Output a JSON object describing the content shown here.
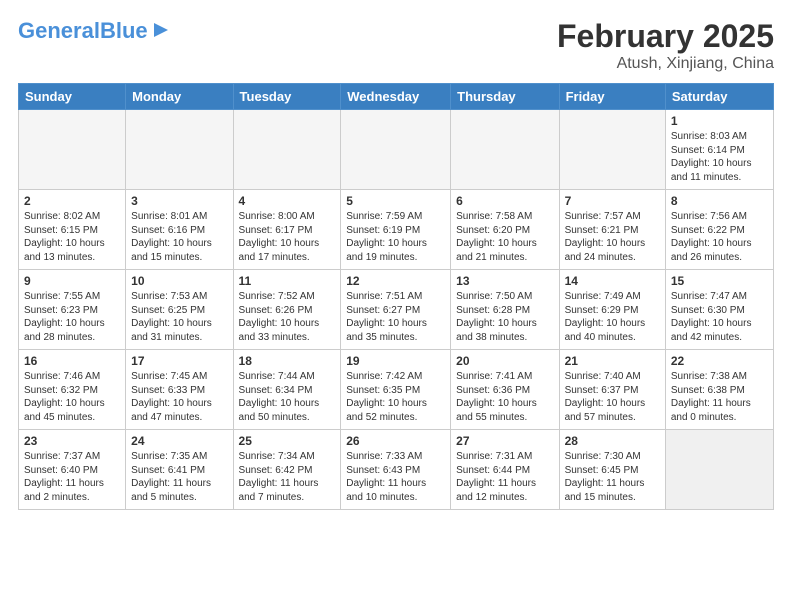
{
  "header": {
    "logo_general": "General",
    "logo_blue": "Blue",
    "title": "February 2025",
    "subtitle": "Atush, Xinjiang, China"
  },
  "days_of_week": [
    "Sunday",
    "Monday",
    "Tuesday",
    "Wednesday",
    "Thursday",
    "Friday",
    "Saturday"
  ],
  "weeks": [
    [
      {
        "day": "",
        "info": "",
        "empty": true
      },
      {
        "day": "",
        "info": "",
        "empty": true
      },
      {
        "day": "",
        "info": "",
        "empty": true
      },
      {
        "day": "",
        "info": "",
        "empty": true
      },
      {
        "day": "",
        "info": "",
        "empty": true
      },
      {
        "day": "",
        "info": "",
        "empty": true
      },
      {
        "day": "1",
        "info": "Sunrise: 8:03 AM\nSunset: 6:14 PM\nDaylight: 10 hours\nand 11 minutes."
      }
    ],
    [
      {
        "day": "2",
        "info": "Sunrise: 8:02 AM\nSunset: 6:15 PM\nDaylight: 10 hours\nand 13 minutes."
      },
      {
        "day": "3",
        "info": "Sunrise: 8:01 AM\nSunset: 6:16 PM\nDaylight: 10 hours\nand 15 minutes."
      },
      {
        "day": "4",
        "info": "Sunrise: 8:00 AM\nSunset: 6:17 PM\nDaylight: 10 hours\nand 17 minutes."
      },
      {
        "day": "5",
        "info": "Sunrise: 7:59 AM\nSunset: 6:19 PM\nDaylight: 10 hours\nand 19 minutes."
      },
      {
        "day": "6",
        "info": "Sunrise: 7:58 AM\nSunset: 6:20 PM\nDaylight: 10 hours\nand 21 minutes."
      },
      {
        "day": "7",
        "info": "Sunrise: 7:57 AM\nSunset: 6:21 PM\nDaylight: 10 hours\nand 24 minutes."
      },
      {
        "day": "8",
        "info": "Sunrise: 7:56 AM\nSunset: 6:22 PM\nDaylight: 10 hours\nand 26 minutes."
      }
    ],
    [
      {
        "day": "9",
        "info": "Sunrise: 7:55 AM\nSunset: 6:23 PM\nDaylight: 10 hours\nand 28 minutes."
      },
      {
        "day": "10",
        "info": "Sunrise: 7:53 AM\nSunset: 6:25 PM\nDaylight: 10 hours\nand 31 minutes."
      },
      {
        "day": "11",
        "info": "Sunrise: 7:52 AM\nSunset: 6:26 PM\nDaylight: 10 hours\nand 33 minutes."
      },
      {
        "day": "12",
        "info": "Sunrise: 7:51 AM\nSunset: 6:27 PM\nDaylight: 10 hours\nand 35 minutes."
      },
      {
        "day": "13",
        "info": "Sunrise: 7:50 AM\nSunset: 6:28 PM\nDaylight: 10 hours\nand 38 minutes."
      },
      {
        "day": "14",
        "info": "Sunrise: 7:49 AM\nSunset: 6:29 PM\nDaylight: 10 hours\nand 40 minutes."
      },
      {
        "day": "15",
        "info": "Sunrise: 7:47 AM\nSunset: 6:30 PM\nDaylight: 10 hours\nand 42 minutes."
      }
    ],
    [
      {
        "day": "16",
        "info": "Sunrise: 7:46 AM\nSunset: 6:32 PM\nDaylight: 10 hours\nand 45 minutes."
      },
      {
        "day": "17",
        "info": "Sunrise: 7:45 AM\nSunset: 6:33 PM\nDaylight: 10 hours\nand 47 minutes."
      },
      {
        "day": "18",
        "info": "Sunrise: 7:44 AM\nSunset: 6:34 PM\nDaylight: 10 hours\nand 50 minutes."
      },
      {
        "day": "19",
        "info": "Sunrise: 7:42 AM\nSunset: 6:35 PM\nDaylight: 10 hours\nand 52 minutes."
      },
      {
        "day": "20",
        "info": "Sunrise: 7:41 AM\nSunset: 6:36 PM\nDaylight: 10 hours\nand 55 minutes."
      },
      {
        "day": "21",
        "info": "Sunrise: 7:40 AM\nSunset: 6:37 PM\nDaylight: 10 hours\nand 57 minutes."
      },
      {
        "day": "22",
        "info": "Sunrise: 7:38 AM\nSunset: 6:38 PM\nDaylight: 11 hours\nand 0 minutes."
      }
    ],
    [
      {
        "day": "23",
        "info": "Sunrise: 7:37 AM\nSunset: 6:40 PM\nDaylight: 11 hours\nand 2 minutes."
      },
      {
        "day": "24",
        "info": "Sunrise: 7:35 AM\nSunset: 6:41 PM\nDaylight: 11 hours\nand 5 minutes."
      },
      {
        "day": "25",
        "info": "Sunrise: 7:34 AM\nSunset: 6:42 PM\nDaylight: 11 hours\nand 7 minutes."
      },
      {
        "day": "26",
        "info": "Sunrise: 7:33 AM\nSunset: 6:43 PM\nDaylight: 11 hours\nand 10 minutes."
      },
      {
        "day": "27",
        "info": "Sunrise: 7:31 AM\nSunset: 6:44 PM\nDaylight: 11 hours\nand 12 minutes."
      },
      {
        "day": "28",
        "info": "Sunrise: 7:30 AM\nSunset: 6:45 PM\nDaylight: 11 hours\nand 15 minutes."
      },
      {
        "day": "",
        "info": "",
        "empty": true,
        "shaded": true
      }
    ]
  ]
}
